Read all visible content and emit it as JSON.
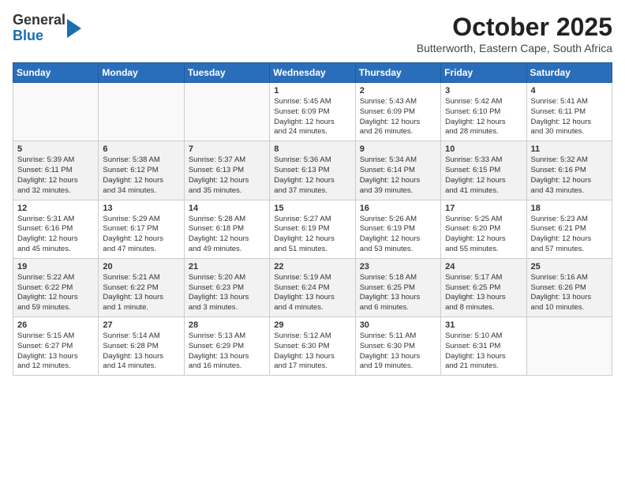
{
  "header": {
    "logo_general": "General",
    "logo_blue": "Blue",
    "month_year": "October 2025",
    "location": "Butterworth, Eastern Cape, South Africa"
  },
  "weekdays": [
    "Sunday",
    "Monday",
    "Tuesday",
    "Wednesday",
    "Thursday",
    "Friday",
    "Saturday"
  ],
  "weeks": [
    [
      {
        "day": "",
        "info": ""
      },
      {
        "day": "",
        "info": ""
      },
      {
        "day": "",
        "info": ""
      },
      {
        "day": "1",
        "info": "Sunrise: 5:45 AM\nSunset: 6:09 PM\nDaylight: 12 hours\nand 24 minutes."
      },
      {
        "day": "2",
        "info": "Sunrise: 5:43 AM\nSunset: 6:09 PM\nDaylight: 12 hours\nand 26 minutes."
      },
      {
        "day": "3",
        "info": "Sunrise: 5:42 AM\nSunset: 6:10 PM\nDaylight: 12 hours\nand 28 minutes."
      },
      {
        "day": "4",
        "info": "Sunrise: 5:41 AM\nSunset: 6:11 PM\nDaylight: 12 hours\nand 30 minutes."
      }
    ],
    [
      {
        "day": "5",
        "info": "Sunrise: 5:39 AM\nSunset: 6:11 PM\nDaylight: 12 hours\nand 32 minutes."
      },
      {
        "day": "6",
        "info": "Sunrise: 5:38 AM\nSunset: 6:12 PM\nDaylight: 12 hours\nand 34 minutes."
      },
      {
        "day": "7",
        "info": "Sunrise: 5:37 AM\nSunset: 6:13 PM\nDaylight: 12 hours\nand 35 minutes."
      },
      {
        "day": "8",
        "info": "Sunrise: 5:36 AM\nSunset: 6:13 PM\nDaylight: 12 hours\nand 37 minutes."
      },
      {
        "day": "9",
        "info": "Sunrise: 5:34 AM\nSunset: 6:14 PM\nDaylight: 12 hours\nand 39 minutes."
      },
      {
        "day": "10",
        "info": "Sunrise: 5:33 AM\nSunset: 6:15 PM\nDaylight: 12 hours\nand 41 minutes."
      },
      {
        "day": "11",
        "info": "Sunrise: 5:32 AM\nSunset: 6:16 PM\nDaylight: 12 hours\nand 43 minutes."
      }
    ],
    [
      {
        "day": "12",
        "info": "Sunrise: 5:31 AM\nSunset: 6:16 PM\nDaylight: 12 hours\nand 45 minutes."
      },
      {
        "day": "13",
        "info": "Sunrise: 5:29 AM\nSunset: 6:17 PM\nDaylight: 12 hours\nand 47 minutes."
      },
      {
        "day": "14",
        "info": "Sunrise: 5:28 AM\nSunset: 6:18 PM\nDaylight: 12 hours\nand 49 minutes."
      },
      {
        "day": "15",
        "info": "Sunrise: 5:27 AM\nSunset: 6:19 PM\nDaylight: 12 hours\nand 51 minutes."
      },
      {
        "day": "16",
        "info": "Sunrise: 5:26 AM\nSunset: 6:19 PM\nDaylight: 12 hours\nand 53 minutes."
      },
      {
        "day": "17",
        "info": "Sunrise: 5:25 AM\nSunset: 6:20 PM\nDaylight: 12 hours\nand 55 minutes."
      },
      {
        "day": "18",
        "info": "Sunrise: 5:23 AM\nSunset: 6:21 PM\nDaylight: 12 hours\nand 57 minutes."
      }
    ],
    [
      {
        "day": "19",
        "info": "Sunrise: 5:22 AM\nSunset: 6:22 PM\nDaylight: 12 hours\nand 59 minutes."
      },
      {
        "day": "20",
        "info": "Sunrise: 5:21 AM\nSunset: 6:22 PM\nDaylight: 13 hours\nand 1 minute."
      },
      {
        "day": "21",
        "info": "Sunrise: 5:20 AM\nSunset: 6:23 PM\nDaylight: 13 hours\nand 3 minutes."
      },
      {
        "day": "22",
        "info": "Sunrise: 5:19 AM\nSunset: 6:24 PM\nDaylight: 13 hours\nand 4 minutes."
      },
      {
        "day": "23",
        "info": "Sunrise: 5:18 AM\nSunset: 6:25 PM\nDaylight: 13 hours\nand 6 minutes."
      },
      {
        "day": "24",
        "info": "Sunrise: 5:17 AM\nSunset: 6:25 PM\nDaylight: 13 hours\nand 8 minutes."
      },
      {
        "day": "25",
        "info": "Sunrise: 5:16 AM\nSunset: 6:26 PM\nDaylight: 13 hours\nand 10 minutes."
      }
    ],
    [
      {
        "day": "26",
        "info": "Sunrise: 5:15 AM\nSunset: 6:27 PM\nDaylight: 13 hours\nand 12 minutes."
      },
      {
        "day": "27",
        "info": "Sunrise: 5:14 AM\nSunset: 6:28 PM\nDaylight: 13 hours\nand 14 minutes."
      },
      {
        "day": "28",
        "info": "Sunrise: 5:13 AM\nSunset: 6:29 PM\nDaylight: 13 hours\nand 16 minutes."
      },
      {
        "day": "29",
        "info": "Sunrise: 5:12 AM\nSunset: 6:30 PM\nDaylight: 13 hours\nand 17 minutes."
      },
      {
        "day": "30",
        "info": "Sunrise: 5:11 AM\nSunset: 6:30 PM\nDaylight: 13 hours\nand 19 minutes."
      },
      {
        "day": "31",
        "info": "Sunrise: 5:10 AM\nSunset: 6:31 PM\nDaylight: 13 hours\nand 21 minutes."
      },
      {
        "day": "",
        "info": ""
      }
    ]
  ]
}
